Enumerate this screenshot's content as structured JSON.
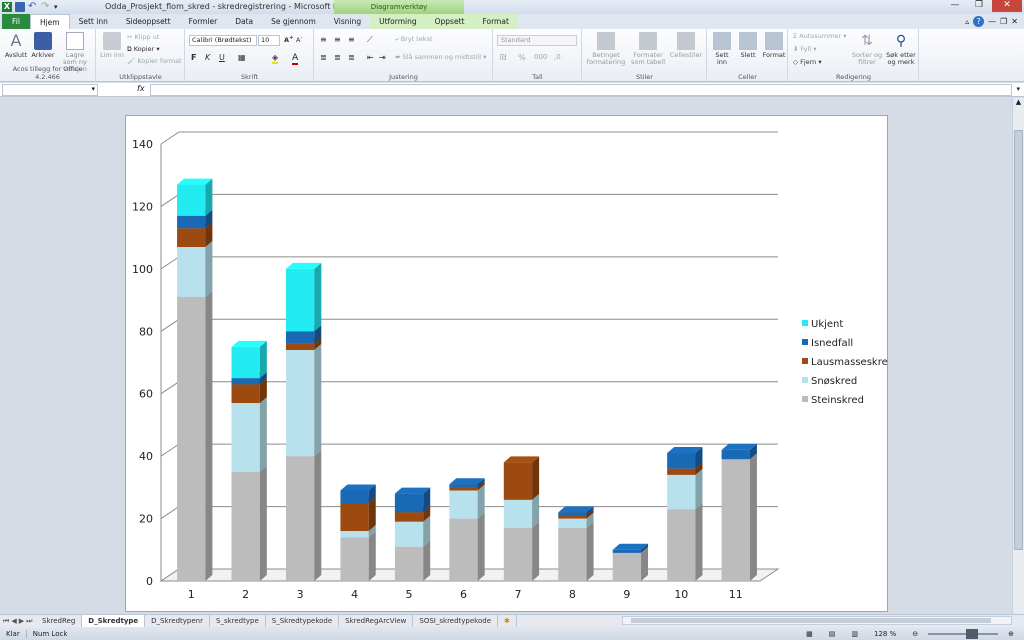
{
  "window": {
    "title": "Odda_Prosjekt_flom_skred - skredregistrering - Microsoft Excel",
    "context_title": "Diagramverktøy"
  },
  "tabs": [
    "Fil",
    "Hjem",
    "Sett inn",
    "Sideoppsett",
    "Formler",
    "Data",
    "Se gjennom",
    "Visning",
    "Utforming",
    "Oppsett",
    "Format"
  ],
  "ribbon": {
    "acos": {
      "avslutt": "Avslutt",
      "arkiver": "Arkiver",
      "lagre": "Lagre som ny versjon",
      "label": "Acos tillegg for Office 4.2.466"
    },
    "clipboard": {
      "lim_inn": "Lim inn",
      "klipp_ut": "Klipp ut",
      "kopier": "Kopier",
      "kopier_format": "Kopier format",
      "label": "Utklippstavle"
    },
    "font": {
      "name": "Calibri (Brødtekst)",
      "size": "10",
      "label": "Skrift"
    },
    "alignment": {
      "bryt_tekst": "Bryt tekst",
      "sla_sammen": "Slå sammen og midtstill",
      "label": "Justering"
    },
    "number": {
      "format": "Standard",
      "label": "Tall"
    },
    "styles": {
      "betinget": "Betinget formatering",
      "formater": "Formater som tabell",
      "cellestiler": "Cellestiler",
      "label": "Stiler"
    },
    "cells": {
      "sett_inn": "Sett inn",
      "slett": "Slett",
      "format": "Format",
      "label": "Celler"
    },
    "editing": {
      "autosummer": "Autosummer",
      "fyll": "Fyll",
      "fjern": "Fjern",
      "sorter": "Sorter og filtrer",
      "sok": "Søk etter og merk",
      "label": "Redigering"
    }
  },
  "formula": {
    "fx": "fx",
    "namebox": ""
  },
  "chart_data": {
    "type": "bar",
    "stacked": true,
    "three_d": true,
    "categories": [
      "1",
      "2",
      "3",
      "4",
      "5",
      "6",
      "7",
      "8",
      "9",
      "10",
      "11"
    ],
    "ylim": [
      0,
      140
    ],
    "yticks": [
      "0",
      "20",
      "40",
      "60",
      "80",
      "100",
      "120",
      "140"
    ],
    "grid": true,
    "legend_position": "right",
    "series": [
      {
        "name": "Steinskred",
        "color": "#bcbcbc",
        "values": [
          91,
          35,
          40,
          14,
          11,
          20,
          17,
          17,
          9,
          23,
          39
        ]
      },
      {
        "name": "Snøskred",
        "color": "#b7e1ec",
        "values": [
          16,
          22,
          34,
          2,
          8,
          9,
          9,
          3,
          0,
          11,
          0
        ]
      },
      {
        "name": "Lausmasseskred",
        "color": "#9c4a0f",
        "values": [
          6,
          6,
          2,
          9,
          3,
          1,
          12,
          1,
          0,
          2,
          0
        ]
      },
      {
        "name": "Isnedfall",
        "color": "#1a69b5",
        "values": [
          4,
          2,
          4,
          4,
          6,
          1,
          0,
          1,
          1,
          5,
          3
        ]
      },
      {
        "name": "Ukjent",
        "color": "#22ebf2",
        "values": [
          10,
          10,
          20,
          0,
          0,
          0,
          0,
          0,
          0,
          0,
          0
        ]
      }
    ]
  },
  "sheets": [
    "SkredReg",
    "D_Skredtype",
    "D_Skredtypenr",
    "S_skredtype",
    "S_Skredtypekode",
    "SkredRegArcView",
    "SOSI_skredtypekode"
  ],
  "active_sheet": "D_Skredtype",
  "status": {
    "ready": "Klar",
    "numlock": "Num Lock",
    "zoom": "128 %"
  }
}
